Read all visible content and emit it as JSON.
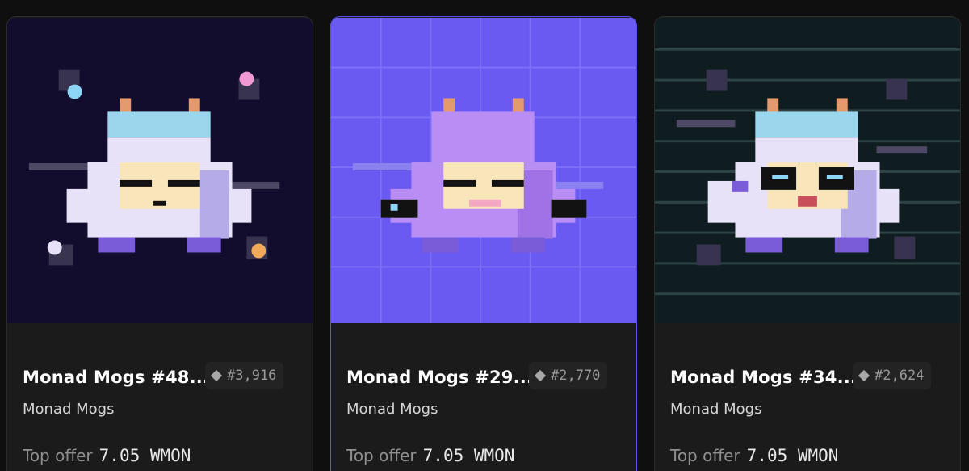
{
  "cards": [
    {
      "title": "Monad Mogs #48...",
      "rank": "#3,916",
      "collection": "Monad Mogs",
      "offer_label": "Top offer",
      "offer_value": "7.05 WMON",
      "background": "dark-starfield"
    },
    {
      "title": "Monad Mogs #29...",
      "rank": "#2,770",
      "collection": "Monad Mogs",
      "offer_label": "Top offer",
      "offer_value": "7.05 WMON",
      "background": "purple-grid"
    },
    {
      "title": "Monad Mogs #34...",
      "rank": "#2,624",
      "collection": "Monad Mogs",
      "offer_label": "Top offer",
      "offer_value": "7.05 WMON",
      "background": "teal-scanlines"
    }
  ],
  "colors": {
    "page_bg": "#0f0f0f",
    "card_bg": "#1b1b1b",
    "hover_border": "#5b4ff0"
  }
}
